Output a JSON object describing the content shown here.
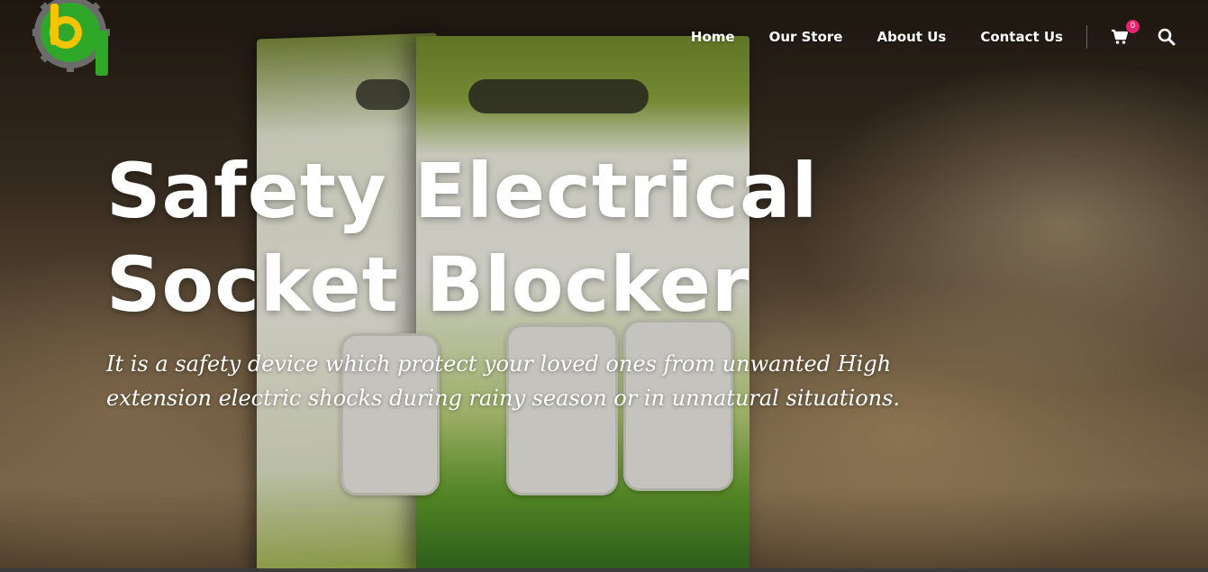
{
  "header": {
    "nav": [
      {
        "label": "Home"
      },
      {
        "label": "Our Store"
      },
      {
        "label": "About Us"
      },
      {
        "label": "Contact Us"
      }
    ],
    "cart": {
      "icon": "cart-icon",
      "count": "0",
      "badge_color": "#e5236e"
    },
    "search": {
      "icon": "search-icon"
    }
  },
  "hero": {
    "title": "Safety Electrical Socket Blocker",
    "subtitle": "It is a safety device which protect your loved ones from unwanted High extension electric shocks during rainy season or in unnatural situations."
  },
  "colors": {
    "logo_green": "#2fa82a",
    "logo_yellow": "#f5c400",
    "logo_gear": "#6b6b6b",
    "text": "#ffffff"
  }
}
